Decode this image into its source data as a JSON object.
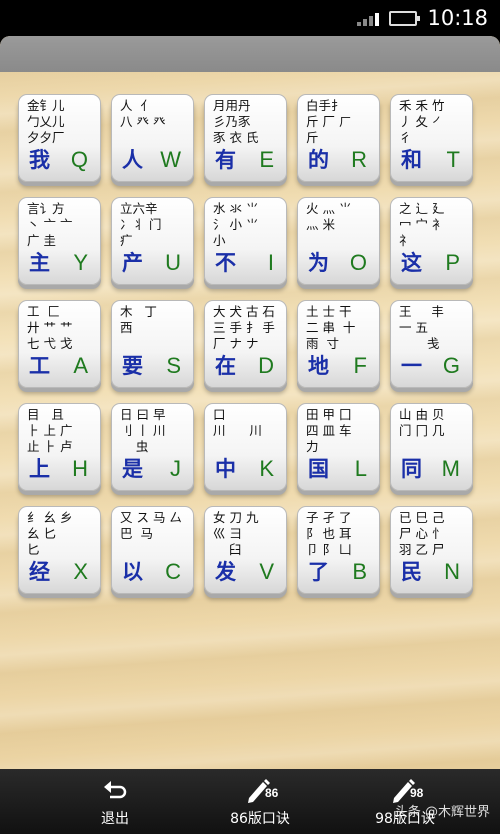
{
  "status_bar": {
    "time": "10:18",
    "signal_icon": "signal-bars-icon",
    "battery_icon": "battery-icon",
    "battery_color": "#4fd02a"
  },
  "colors": {
    "key_char": "#1a2fa8",
    "key_letter": "#1f7a1f"
  },
  "keys": [
    {
      "roots": "金钅儿\n勹乂儿\n夕夕厂",
      "char": "我",
      "letter": "Q"
    },
    {
      "roots": "人  亻\n八 癶 癶",
      "char": "人",
      "letter": "W"
    },
    {
      "roots": "月用丹\n彡乃豕\n豕 衣 氏",
      "char": "有",
      "letter": "E"
    },
    {
      "roots": "白手扌\n斤 厂 ㄏ\n斤",
      "char": "的",
      "letter": "R"
    },
    {
      "roots": "禾 禾 竹\n丿 夂 ㇒\n彳",
      "char": "和",
      "letter": "T"
    },
    {
      "roots": "言讠方\n丶 亠 亠\n广 圭",
      "char": "主",
      "letter": "Y"
    },
    {
      "roots": "立六辛\n冫丬 门\n疒",
      "char": "产",
      "letter": "U"
    },
    {
      "roots": "水 氺 ⺌\n氵 小 ⺌\n小",
      "char": "不",
      "letter": "I"
    },
    {
      "roots": "火 灬 ⺌\n灬 米",
      "char": "为",
      "letter": "O"
    },
    {
      "roots": "之 辶 廴\n冖 宀 衤\n礻",
      "char": "这",
      "letter": "P"
    },
    {
      "roots": "工  匚\n廾 艹 艹\n七 弋 戈",
      "char": "工",
      "letter": "A"
    },
    {
      "roots": "木   丁\n西",
      "char": "要",
      "letter": "S"
    },
    {
      "roots": "大 犬 古 石\n三 手 ⺘ 手\n厂 ナ ナ",
      "char": "在",
      "letter": "D"
    },
    {
      "roots": "土 士 干\n二 串  十\n雨  寸",
      "char": "地",
      "letter": "F"
    },
    {
      "roots": "王     丰\n一 五\n       戋",
      "char": "一",
      "letter": "G"
    },
    {
      "roots": "目   且\n⺊ 上 广\n止 ⺊ 卢",
      "char": "上",
      "letter": "H"
    },
    {
      "roots": "日 曰 早\n刂 丨 川\n    虫",
      "char": "是",
      "letter": "J"
    },
    {
      "roots": "口\n川      川",
      "char": "中",
      "letter": "K"
    },
    {
      "roots": "田 甲 囗\n四 皿 车\n力",
      "char": "国",
      "letter": "L"
    },
    {
      "roots": "山 由 贝\n门 冂 几",
      "char": "同",
      "letter": "M"
    },
    {
      "roots": "纟 幺 乡\n幺 匕\n匕",
      "char": "经",
      "letter": "X"
    },
    {
      "roots": "又 ス 马 厶\n巴  马",
      "char": "以",
      "letter": "C"
    },
    {
      "roots": "女 刀 九\n巛 彐\n    臼",
      "char": "发",
      "letter": "V"
    },
    {
      "roots": "子 孑 了\n阝 也 耳\n卩 阝 凵",
      "char": "了",
      "letter": "B"
    },
    {
      "roots": "已 巳 己\n尸 心 忄\n羽 乙 尸",
      "char": "民",
      "letter": "N"
    }
  ],
  "nav": [
    {
      "icon": "back-arrow-icon",
      "label": "退出"
    },
    {
      "icon": "pencil-icon",
      "badge": "86",
      "label": "86版口诀"
    },
    {
      "icon": "pencil-icon",
      "badge": "98",
      "label": "98版口诀"
    }
  ],
  "watermark": "头条 @木辉世界"
}
